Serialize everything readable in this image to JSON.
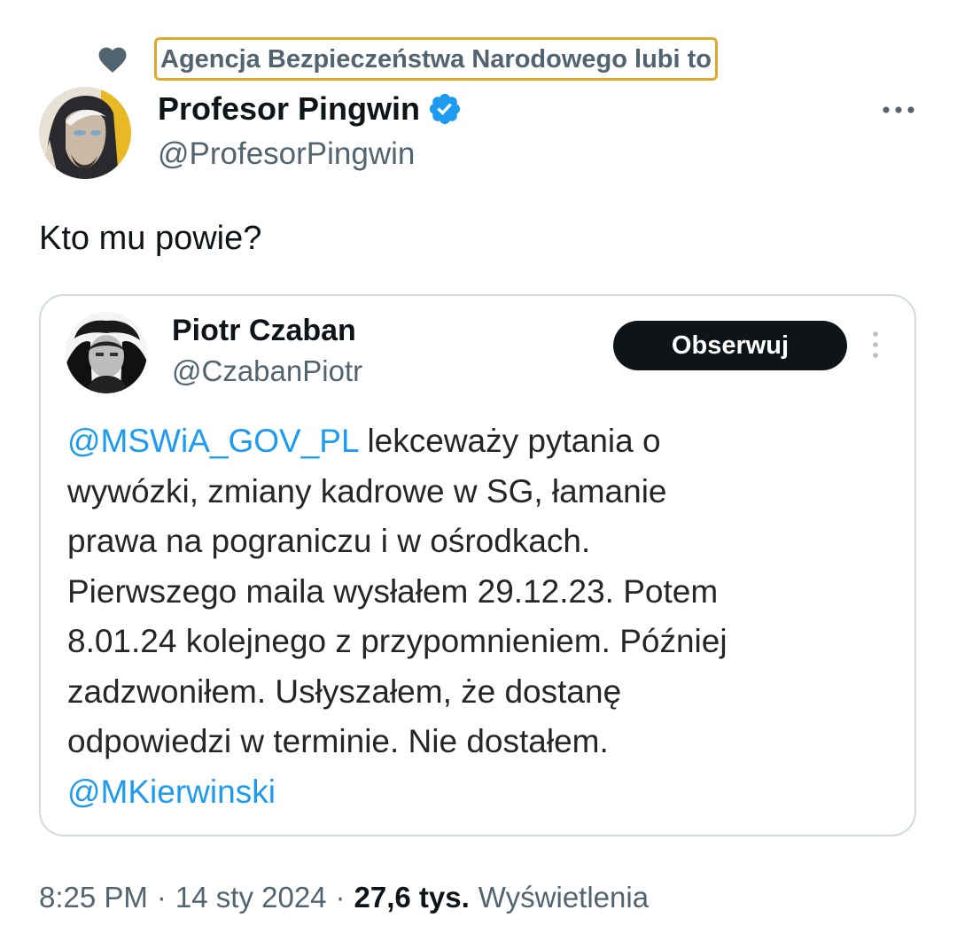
{
  "social_context": {
    "icon": "heart-icon",
    "text": "Agencja Bezpieczeństwa Narodowego lubi to",
    "highlight_color": "#e0a82e"
  },
  "author": {
    "name": "Profesor Pingwin",
    "handle": "@ProfesorPingwin",
    "verified": true,
    "verified_color": "#1d9bf0"
  },
  "more_icon": "more-horizontal-icon",
  "tweet": {
    "text": "Kto mu powie?"
  },
  "quoted": {
    "name": "Piotr Czaban",
    "handle": "@CzabanPiotr",
    "follow_label": "Obserwuj",
    "more_icon": "more-vertical-icon",
    "mention_1": "@MSWiA_GOV_PL",
    "line_1_rest": " lekceważy pytania o",
    "lines": [
      "wywózki, zmiany kadrowe w SG, łamanie",
      "prawa na pograniczu i w ośrodkach.",
      "Pierwszego maila wysłałem 29.12.23. Potem",
      "8.01.24 kolejnego z przypomnieniem. Później",
      "zadzwoniłem. Usłyszałem, że dostanę",
      "odpowiedzi w terminie. Nie dostałem."
    ],
    "mention_2": "@MKierwinski",
    "link_color": "#1d9bf0"
  },
  "meta": {
    "time": "8:25 PM",
    "separator": "·",
    "date": "14 sty 2024",
    "views_count": "27,6 tys.",
    "views_label": "Wyświetlenia"
  }
}
